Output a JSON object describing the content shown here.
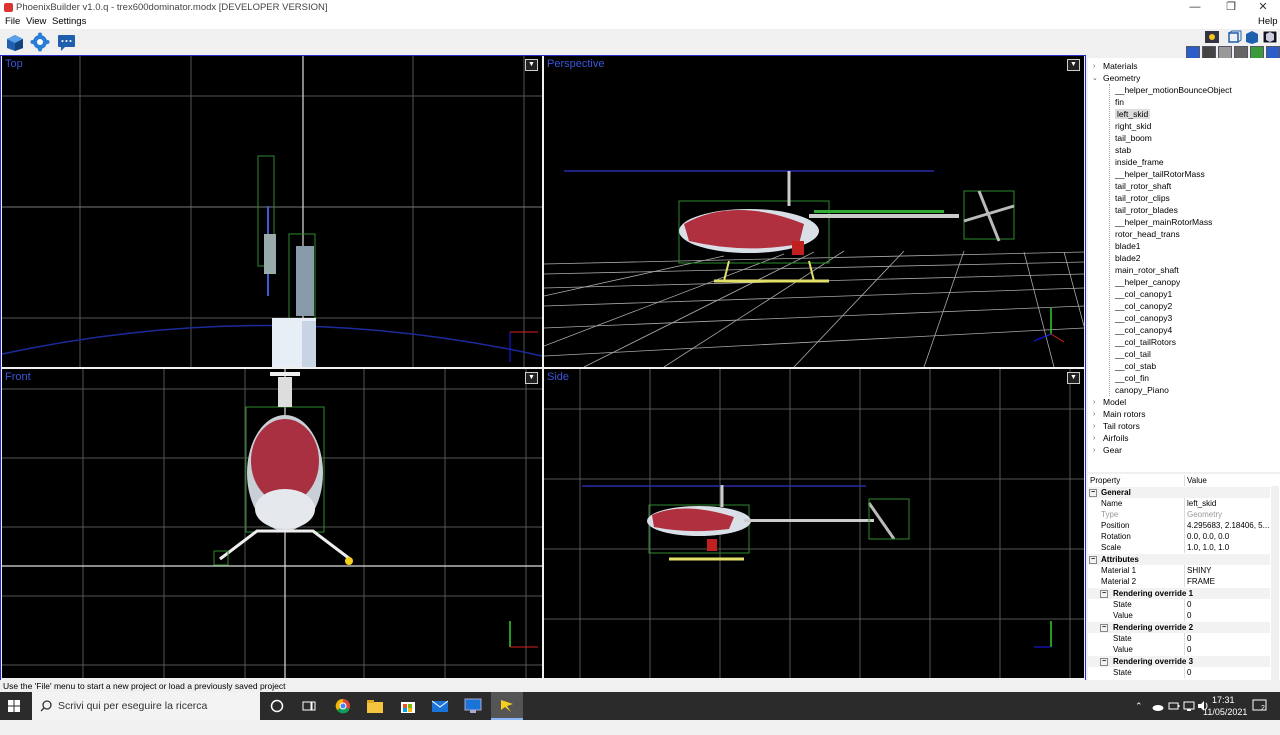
{
  "window": {
    "title": "PhoenixBuilder v1.0.q - trex600dominator.modx [DEVELOPER VERSION]",
    "controls": {
      "minimize": "—",
      "restore": "❐",
      "close": "✕"
    }
  },
  "menu": {
    "file": "File",
    "view": "View",
    "settings": "Settings",
    "help": "Help"
  },
  "viewports": {
    "top": {
      "label": "Top",
      "menu": "▼"
    },
    "perspective": {
      "label": "Perspective",
      "menu": "▼"
    },
    "front": {
      "label": "Front",
      "menu": "▼"
    },
    "side": {
      "label": "Side",
      "menu": "▼"
    }
  },
  "tree": {
    "materials": "Materials",
    "geometry": "Geometry",
    "geometry_children": [
      "__helper_motionBounceObject",
      "fin",
      "left_skid",
      "right_skid",
      "tail_boom",
      "stab",
      "inside_frame",
      "__helper_tailRotorMass",
      "tail_rotor_shaft",
      "tail_rotor_clips",
      "tail_rotor_blades",
      "__helper_mainRotorMass",
      "rotor_head_trans",
      "blade1",
      "blade2",
      "main_rotor_shaft",
      "__helper_canopy",
      "__col_canopy1",
      "__col_canopy2",
      "__col_canopy3",
      "__col_canopy4",
      "__col_tailRotors",
      "__col_tail",
      "__col_stab",
      "__col_fin",
      "canopy_Piano"
    ],
    "selected": "left_skid",
    "model": "Model",
    "main_rotors": "Main rotors",
    "tail_rotors": "Tail rotors",
    "airfoils": "Airfoils",
    "gear": "Gear"
  },
  "properties": {
    "header_property": "Property",
    "header_value": "Value",
    "general": "General",
    "name_k": "Name",
    "name_v": "left_skid",
    "type_k": "Type",
    "type_v": "Geometry",
    "position_k": "Position",
    "position_v": "4.295683, 2.18406, 5...",
    "rotation_k": "Rotation",
    "rotation_v": "0.0, 0.0, 0.0",
    "scale_k": "Scale",
    "scale_v": "1.0, 1.0, 1.0",
    "attributes": "Attributes",
    "material1_k": "Material 1",
    "material1_v": "SHINY",
    "material2_k": "Material 2",
    "material2_v": "FRAME",
    "ro1": "Rendering override 1",
    "ro2": "Rendering override 2",
    "ro3": "Rendering override 3",
    "state_k": "State",
    "value_k": "Value",
    "zero": "0"
  },
  "status": "Use the 'File' menu to start a new project or load a previously saved project",
  "taskbar": {
    "search_placeholder": "Scrivi qui per eseguire la ricerca",
    "time": "17:31",
    "date": "11/05/2021",
    "notifications": "2"
  },
  "colors": {
    "accent": "#2a2acc",
    "viewport_bg": "#000000",
    "grid": "#6a6a6a",
    "label": "#3a56d8"
  }
}
